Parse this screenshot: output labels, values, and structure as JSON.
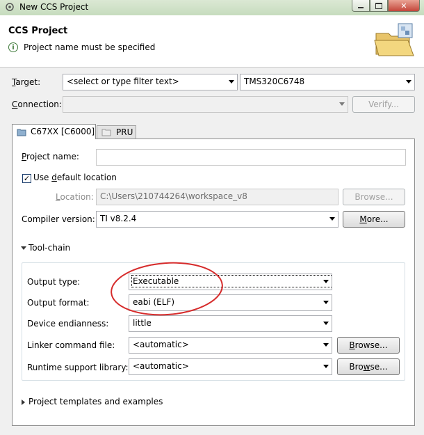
{
  "window": {
    "title": "New CCS Project"
  },
  "banner": {
    "title": "CCS Project",
    "message": "Project name must be specified"
  },
  "target": {
    "label": "Target:",
    "filter_placeholder": "<select or type filter text>",
    "device": "TMS320C6748"
  },
  "connection": {
    "label": "Connection:",
    "value": "",
    "verify_label": "Verify..."
  },
  "tabs": [
    {
      "label": "C67XX [C6000]",
      "selected": true
    },
    {
      "label": "PRU",
      "selected": false
    }
  ],
  "project": {
    "name_label": "Project name:",
    "name_value": "",
    "use_default_label": "Use default location",
    "use_default_checked": true,
    "location_label": "Location:",
    "location_value": "C:\\Users\\210744264\\workspace_v8",
    "browse_label": "Browse...",
    "compiler_label": "Compiler version:",
    "compiler_value": "TI v8.2.4",
    "more_label": "More..."
  },
  "toolchain": {
    "section_label": "Tool-chain",
    "expanded": true,
    "output_type_label": "Output type:",
    "output_type_value": "Executable",
    "output_format_label": "Output format:",
    "output_format_value": "eabi (ELF)",
    "endianness_label": "Device endianness:",
    "endianness_value": "little",
    "linker_label": "Linker command file:",
    "linker_value": "<automatic>",
    "linker_browse": "Browse...",
    "runtime_label": "Runtime support library:",
    "runtime_value": "<automatic>",
    "runtime_browse": "Browse...",
    "annotation_color": "#d62c2c"
  },
  "templates": {
    "section_label": "Project templates and examples",
    "expanded": false
  }
}
